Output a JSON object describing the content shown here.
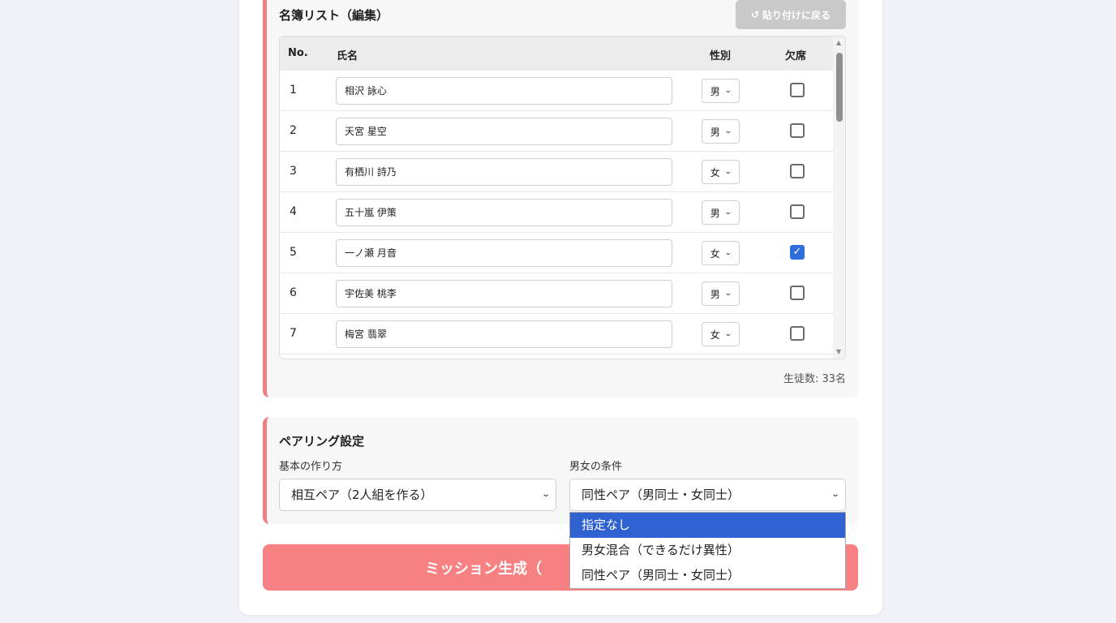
{
  "roster": {
    "title": "名簿リスト（編集）",
    "restore_icon": "↺",
    "restore_label": "貼り付けに戻る",
    "headers": {
      "no": "No.",
      "name": "氏名",
      "sex": "性別",
      "absent": "欠席"
    },
    "rows": [
      {
        "no": "1",
        "name": "相沢 詠心",
        "sex": "男",
        "absent": false
      },
      {
        "no": "2",
        "name": "天宮 星空",
        "sex": "男",
        "absent": false
      },
      {
        "no": "3",
        "name": "有栖川 詩乃",
        "sex": "女",
        "absent": false
      },
      {
        "no": "4",
        "name": "五十嵐 伊策",
        "sex": "男",
        "absent": false
      },
      {
        "no": "5",
        "name": "一ノ瀬 月音",
        "sex": "女",
        "absent": true
      },
      {
        "no": "6",
        "name": "宇佐美 桃李",
        "sex": "男",
        "absent": false
      },
      {
        "no": "7",
        "name": "梅宮 翡翠",
        "sex": "女",
        "absent": false
      }
    ],
    "student_count": "生徒数: 33名"
  },
  "pairing": {
    "title": "ペアリング設定",
    "method_label": "基本の作り方",
    "method_value": "相互ペア（2人組を作る）",
    "gender_label": "男女の条件",
    "gender_value": "同性ペア（男同士・女同士）",
    "gender_options": [
      "指定なし",
      "男女混合（できるだけ異性）",
      "同性ペア（男同士・女同士）"
    ]
  },
  "generate_label": "ミッション生成（",
  "colors": {
    "accent": "#f78083",
    "panel_border": "#f07f84",
    "highlight": "#2f62d0",
    "checkbox_checked": "#2f6fdc"
  }
}
